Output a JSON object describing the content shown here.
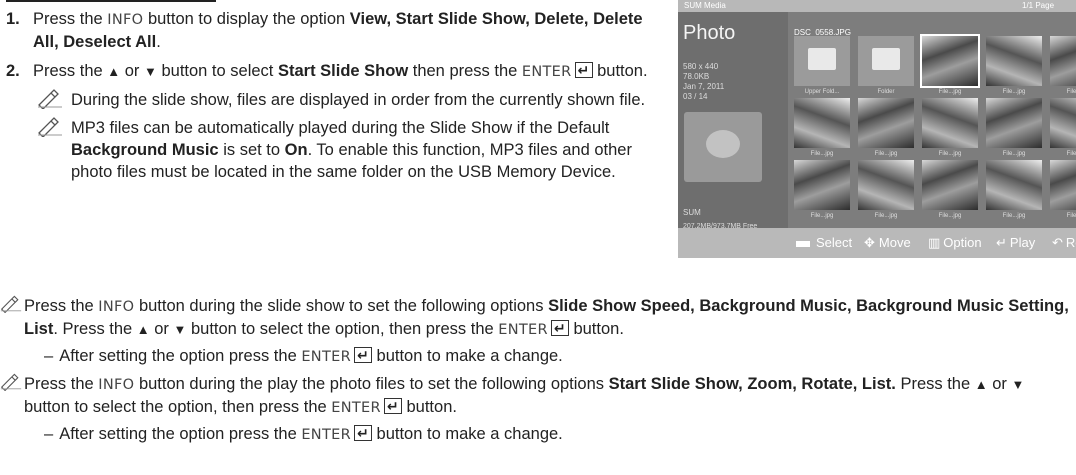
{
  "steps": [
    {
      "number": "1.",
      "t1": "Press the ",
      "info": "INFO",
      "t2": " button to display the option ",
      "opts": "View, Start Slide Show, Delete, Delete All, Deselect All",
      "t3": "."
    },
    {
      "number": "2.",
      "t1": "Press the ",
      "up": "▲",
      "or": " or ",
      "down": "▼",
      "t2": " button to select ",
      "target": "Start Slide Show",
      "t3": " then press the ",
      "enter": "ENTER",
      "t4": " button.",
      "notes": [
        {
          "text": "During the slide show, files are displayed in order from the currently shown file."
        },
        {
          "t1": "MP3 files can be automatically played during the Slide Show if the Default ",
          "bold1": "Background Music",
          "t2": " is set to ",
          "bold2": "On",
          "t3": ". To enable this function, MP3 files and other photo files must be located in the same folder on the USB Memory Device."
        }
      ]
    }
  ],
  "tv": {
    "top_left": "SUM Media",
    "top_right": "1/1 Page",
    "title": "Photo",
    "file_name": "DSC_0558.JPG",
    "meta": [
      "580 x 440",
      "78.0KB",
      "Jan 7, 2011",
      "03 / 14"
    ],
    "sum": "SUM",
    "free": "207.2MB/973.7MB Free",
    "captions": {
      "upper_folder": "Upper Fold...",
      "folder": "Folder",
      "file": "File...jpg"
    },
    "bottom": {
      "select": "Select",
      "move": "Move",
      "option": "Option",
      "play": "Play",
      "return": "Re"
    }
  },
  "paras": [
    {
      "t1": "Press the ",
      "info": "INFO",
      "t2": " button during the slide show to set the following options ",
      "opts": "Slide Show Speed, Background Music, Background Music Setting, List",
      "t3": ". Press the ",
      "up": "▲",
      "or": " or ",
      "down": "▼",
      "t4": " button to select the option, then press the ",
      "enter": "ENTER",
      "t5": " button.",
      "sub": {
        "dash": "–",
        "t1": "After setting the option press the ",
        "enter": "ENTER",
        "t2": " button to make a change."
      }
    },
    {
      "t1": "Press the ",
      "info": "INFO",
      "t2": " button during the play the photo files to set the following options ",
      "opts": "Start Slide Show, Zoom, Rotate, List.",
      "t3": " Press the ",
      "up": "▲",
      "or": " or ",
      "down": "▼",
      "t4": " button to select the option, then press the ",
      "enter": "ENTER",
      "t5": " button.",
      "sub": {
        "dash": "–",
        "t1": "After setting the option press the ",
        "enter": "ENTER",
        "t2": " button to make a change."
      }
    }
  ]
}
